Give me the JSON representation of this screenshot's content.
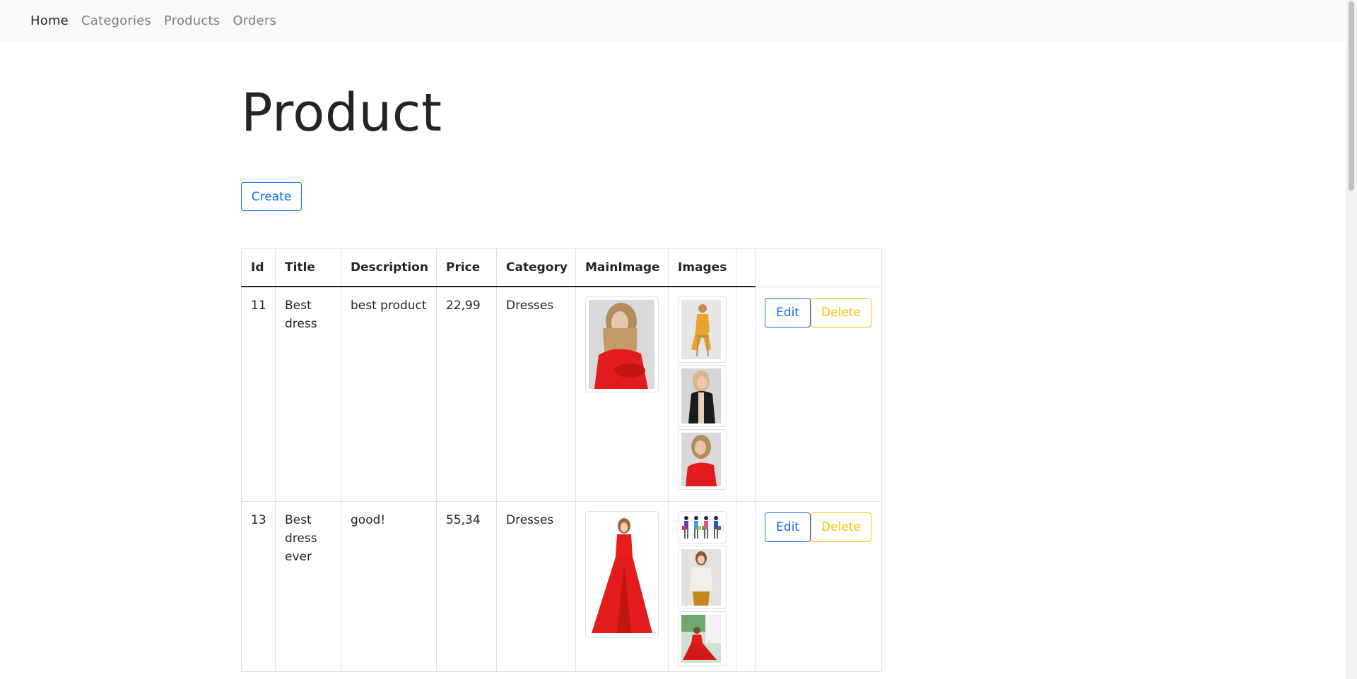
{
  "nav": {
    "items": [
      {
        "label": "Home"
      },
      {
        "label": "Categories"
      },
      {
        "label": "Products"
      },
      {
        "label": "Orders"
      }
    ]
  },
  "page": {
    "title": "Product",
    "create_label": "Create"
  },
  "table": {
    "headers": [
      "Id",
      "Title",
      "Description",
      "Price",
      "Category",
      "MainImage",
      "Images",
      "",
      ""
    ],
    "rows": [
      {
        "id": "11",
        "title": "Best dress",
        "description": "best product",
        "price": "22,99",
        "category": "Dresses",
        "main_image": "model-red-sweater-photo",
        "images": [
          "model-yellow-outfit-on-stool-photo",
          "model-black-jacket-photo",
          "model-red-sweater-photo"
        ],
        "edit_label": "Edit",
        "delete_label": "Delete"
      },
      {
        "id": "13",
        "title": "Best dress ever",
        "description": "good!",
        "price": "55,34",
        "category": "Dresses",
        "main_image": "model-red-gown-photo",
        "images": [
          "shopping-women-illustration",
          "model-white-blouse-photo",
          "model-red-dress-garden-photo"
        ],
        "edit_label": "Edit",
        "delete_label": "Delete"
      }
    ]
  },
  "colors": {
    "primary": "#0d6efd",
    "warning": "#ffc107",
    "navbar_bg": "#f8f9fa",
    "nav_inactive": "#7f7f7f"
  }
}
